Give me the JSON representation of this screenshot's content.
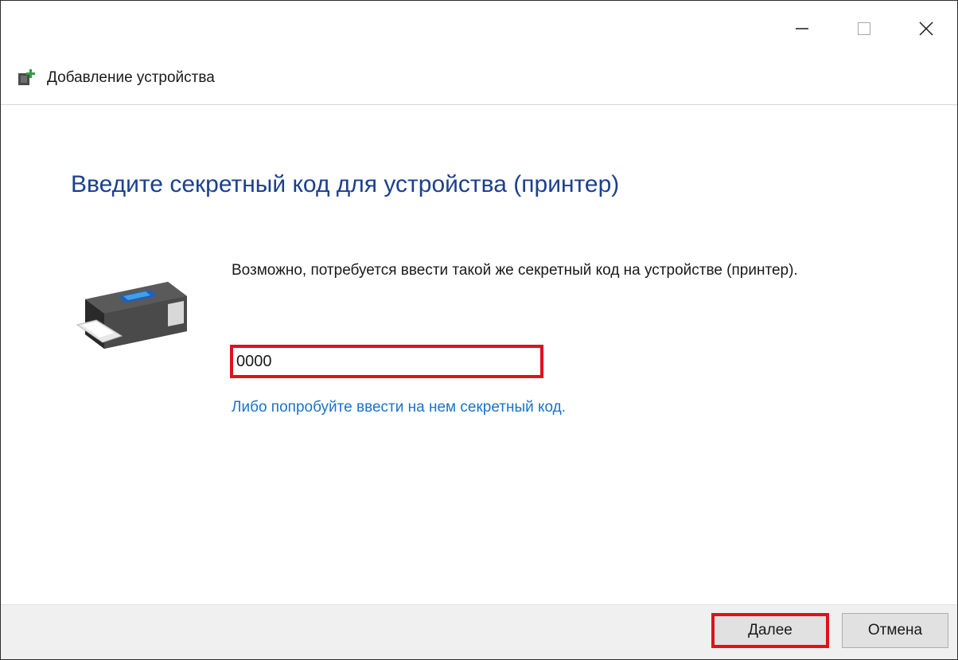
{
  "window": {
    "title": "Добавление устройства",
    "controls": {
      "minimize_icon": "minimize-icon",
      "maximize_icon": "maximize-icon",
      "close_icon": "close-icon"
    }
  },
  "main": {
    "heading": "Введите секретный код для устройства (принтер)",
    "device_icon": "printer-icon",
    "description": "Возможно, потребуется ввести такой же секретный код на устройстве (принтер).",
    "code_input": {
      "value": "0000",
      "placeholder": ""
    },
    "alt_link": "Либо попробуйте ввести на нем секретный код."
  },
  "footer": {
    "next_label": "Далее",
    "cancel_label": "Отмена"
  },
  "colors": {
    "heading": "#1c3f8f",
    "link": "#1a73c8",
    "highlight": "#e0101e",
    "footer_bg": "#f0f0f0"
  }
}
